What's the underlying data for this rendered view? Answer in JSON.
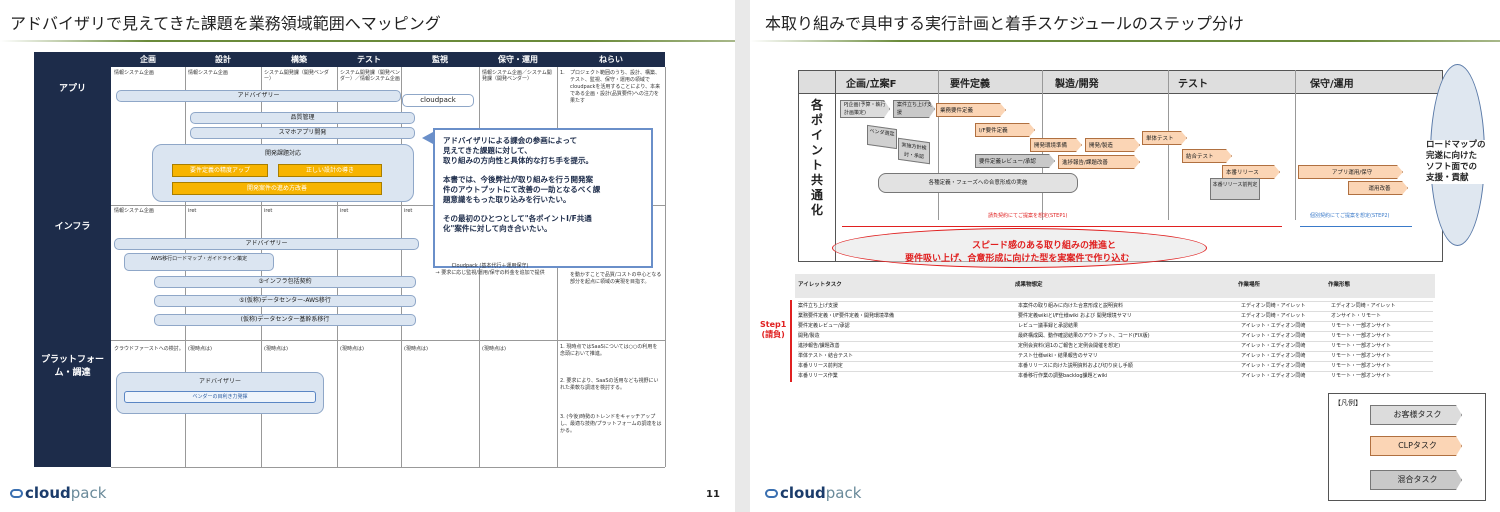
{
  "slide1": {
    "title": "アドバイザリで見えてきた課題を業務領域範囲へマッピング",
    "page_number": "11",
    "logo": {
      "brand": "cloud",
      "suffix": "pack"
    },
    "columns": [
      "企画",
      "設計",
      "構築",
      "テスト",
      "監視",
      "保守・運用",
      "ねらい"
    ],
    "rows": [
      "アプリ",
      "インフラ",
      "プラットフォーム・調達"
    ],
    "app": {
      "cells": [
        "情報システム企画",
        "情報システム企画",
        "システム開発課（開発ベンダー）",
        "システム開発課（開発ベンダー）／情報システム企画",
        "",
        "情報システム企画／システム開発課（開発ベンダー）"
      ],
      "bars": [
        "アドバイザリー",
        "cloudpack",
        "品質管理",
        "スマホアプリ開発",
        "開発課題対応"
      ],
      "orange": [
        "要件定義の精度アップ",
        "正しい設計の導き",
        "開発案件の進め方改善"
      ],
      "callout": [
        "アドバイザリによる課会の参画によって",
        "見えてきた課題に対して、",
        "取り組みの方向性と具体的な打ち手を提示。",
        "本書では、今後弊社が取り組みを行う開発案",
        "件のアウトプットにて改善の一助となるべく課",
        "題意識をもった取り込みを行いたい。",
        "その最初のひとつとして\"各ポイントI/F共通",
        "化\"案件に対して向き合いたい。"
      ],
      "aim": [
        "1.",
        "プロジェクト範囲のうち、設計、構築、テスト、監視、保守・運用の領域でcloudpackを活用することにより、本来である企画・設計(品質要件)への注力を果たす"
      ]
    },
    "infra": {
      "cells": [
        "情報システム企画",
        "iret",
        "iret",
        "iret",
        "iret"
      ],
      "bars": [
        "アドバイザリー",
        "AWS移行ロードマップ・ガイドライン策定",
        "③インフラ包括契約",
        "⑤(仮称)データセンター-AWS移行",
        "(仮称)データセンター基幹系移行"
      ],
      "cloudpack_note": [
        "Cloudpack (基本代行＋運用保守)",
        "→ 要求に応じ監視/運用/保守の料金を追加で提供"
      ],
      "aim": "を動かすことで品質/コストの中心となる部分を起点に領域の実現を目指す。"
    },
    "platform": {
      "cells": [
        "クラウドファーストへの検討。",
        "(現時点は)",
        "(現時点は)",
        "(現時点は)",
        "(現時点は)",
        "(現時点は)"
      ],
      "bars": [
        "アドバイザリー",
        "ベンダーの目利き力発揮"
      ],
      "aim": [
        "1. 現時点ではSaaSについては○○の利用を念頭において推進。",
        "2. 要求により、SaaSの活用なども視野にいれた柔軟な調達を検討する。",
        "3. (今後)時勢のトレンドをキャッチアップし、最適な技術/プラットフォームの調達をはかる。"
      ]
    }
  },
  "slide2": {
    "title": "本取り組みで具申する実行計画と着手スケジュールのステップ分け",
    "logo": {
      "brand": "cloud",
      "suffix": "pack"
    },
    "phases": [
      "企画/立案F",
      "要件定義",
      "製造/開発",
      "テスト",
      "保守/運用"
    ],
    "vertical_label": "各ポイント共通化",
    "tasks": [
      "PJ企画(予算・執行計画策定)",
      "案件立ち上げ支援",
      "業務要件定義",
      "ベンダ選定",
      "I/F要件定義",
      "実施方針検討・承認",
      "開発環境準備",
      "開発/製造",
      "単体テスト",
      "要件定義レビュー/承認",
      "進捗報告/課題改善",
      "結合テスト",
      "本番リリース",
      "本番リリース前判定",
      "アプリ運用/保守",
      "運用改善",
      "各種定義・フェーズへの合意形成の実施"
    ],
    "step1_note": "請負契約にてご提案を想定(STEP1)",
    "step2_note": "個別契約にてご提案を想定(STEP2)",
    "red_oval": [
      "スピード感のある取り組みの推進と",
      "要件吸い上げ、合意形成に向けた型を実案件で作り込む"
    ],
    "goal": [
      "ロードマップの",
      "完遂に向けた",
      "ソフト面での",
      "支援・貢献"
    ],
    "table_headers": [
      "アイレットタスク",
      "成果物想定",
      "作業場所",
      "作業形態"
    ],
    "table_rows": [
      [
        "案件立ち上げ支援",
        "本案件の取り組みに向けた合意形成と説明資料",
        "エディオン同崎・アイレット",
        "エディオン同崎・アイレット"
      ],
      [
        "業務要件定義・I/F要件定義・開発環境準備",
        "要件定義wikiとI/F仕様wiki および 開発環境サマリ",
        "エディオン同崎・アイレット",
        "オンサイト・リモート"
      ],
      [
        "要件定義レビュー/承認",
        "レビュー議事録と承認結果",
        "アイレット・エディオン同崎",
        "リモート・一部オンサイト"
      ],
      [
        "開発/製造",
        "最終構成図、動作確認結果のアウトプット、コード(FIX版)",
        "アイレット・エディオン同崎",
        "リモート・一部オンサイト"
      ],
      [
        "進捗報告/課題改善",
        "定例会資料(週1のご報告と定例会開催を想定)",
        "アイレット・エディオン同崎",
        "リモート・一部オンサイト"
      ],
      [
        "単体テスト・結合テスト",
        "テスト仕様wiki・結果報告のサマリ",
        "アイレット・エディオン同崎",
        "リモート・一部オンサイト"
      ],
      [
        "本番リリース前判定",
        "本番リリースに向けた説明資料および切り戻し手順",
        "アイレット・エディオン同崎",
        "リモート・一部オンサイト"
      ],
      [
        "本番リリース作業",
        "本番移行作業の調整backlog課題とwiki",
        "アイレット・エディオン同崎",
        "リモート・一部オンサイト"
      ]
    ],
    "step1_label": [
      "Step1",
      "(請負)"
    ],
    "legend": {
      "title": "【凡例】",
      "items": [
        "お客様タスク",
        "CLPタスク",
        "混合タスク"
      ]
    },
    "colors": {
      "customer": "#dcdcdc",
      "clp": "#fbd5b5",
      "mixed": "#c9c9c9",
      "accent_red": "#e02020",
      "navy": "#1d2c4a"
    }
  }
}
